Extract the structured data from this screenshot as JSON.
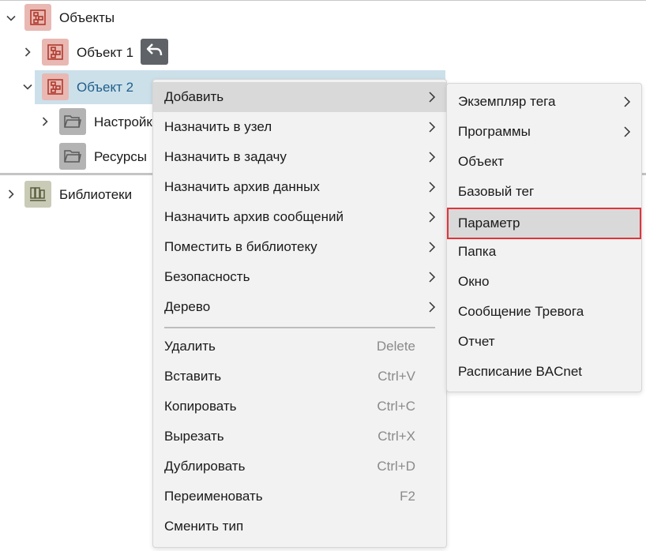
{
  "tree": {
    "root_label": "Объекты",
    "object1_label": "Объект 1",
    "object2_label": "Объект 2",
    "settings_label": "Настройки",
    "resources_label": "Ресурсы",
    "libraries_label": "Библиотеки"
  },
  "icons": {
    "object": "object-schema-icon",
    "folder": "folder-icon",
    "library": "library-icon",
    "undo": "undo-icon"
  },
  "colors": {
    "selection": "#cce0ea",
    "object_icon_bg": "#e9b8b2",
    "highlight_border": "#e0343b",
    "menu_bg": "#f2f2f2"
  },
  "context_menu": {
    "items": [
      {
        "label": "Добавить"
      },
      {
        "label": "Назначить в узел"
      },
      {
        "label": "Назначить в задачу"
      },
      {
        "label": "Назначить архив данных"
      },
      {
        "label": "Назначить архив сообщений"
      },
      {
        "label": "Поместить в библиотеку"
      },
      {
        "label": "Безопасность"
      },
      {
        "label": "Дерево"
      }
    ],
    "actions": [
      {
        "label": "Удалить",
        "shortcut": "Delete"
      },
      {
        "label": "Вставить",
        "shortcut": "Ctrl+V"
      },
      {
        "label": "Копировать",
        "shortcut": "Ctrl+C"
      },
      {
        "label": "Вырезать",
        "shortcut": "Ctrl+X"
      },
      {
        "label": "Дублировать",
        "shortcut": "Ctrl+D"
      },
      {
        "label": "Переименовать",
        "shortcut": "F2"
      },
      {
        "label": "Сменить тип",
        "shortcut": ""
      }
    ]
  },
  "submenu": {
    "items": [
      {
        "label": "Экземпляр тега"
      },
      {
        "label": "Программы"
      },
      {
        "label": "Объект"
      },
      {
        "label": "Базовый тег"
      },
      {
        "label": "Параметр"
      },
      {
        "label": "Папка"
      },
      {
        "label": "Окно"
      },
      {
        "label": "Сообщение Тревога"
      },
      {
        "label": "Отчет"
      },
      {
        "label": "Расписание BACnet"
      }
    ]
  }
}
